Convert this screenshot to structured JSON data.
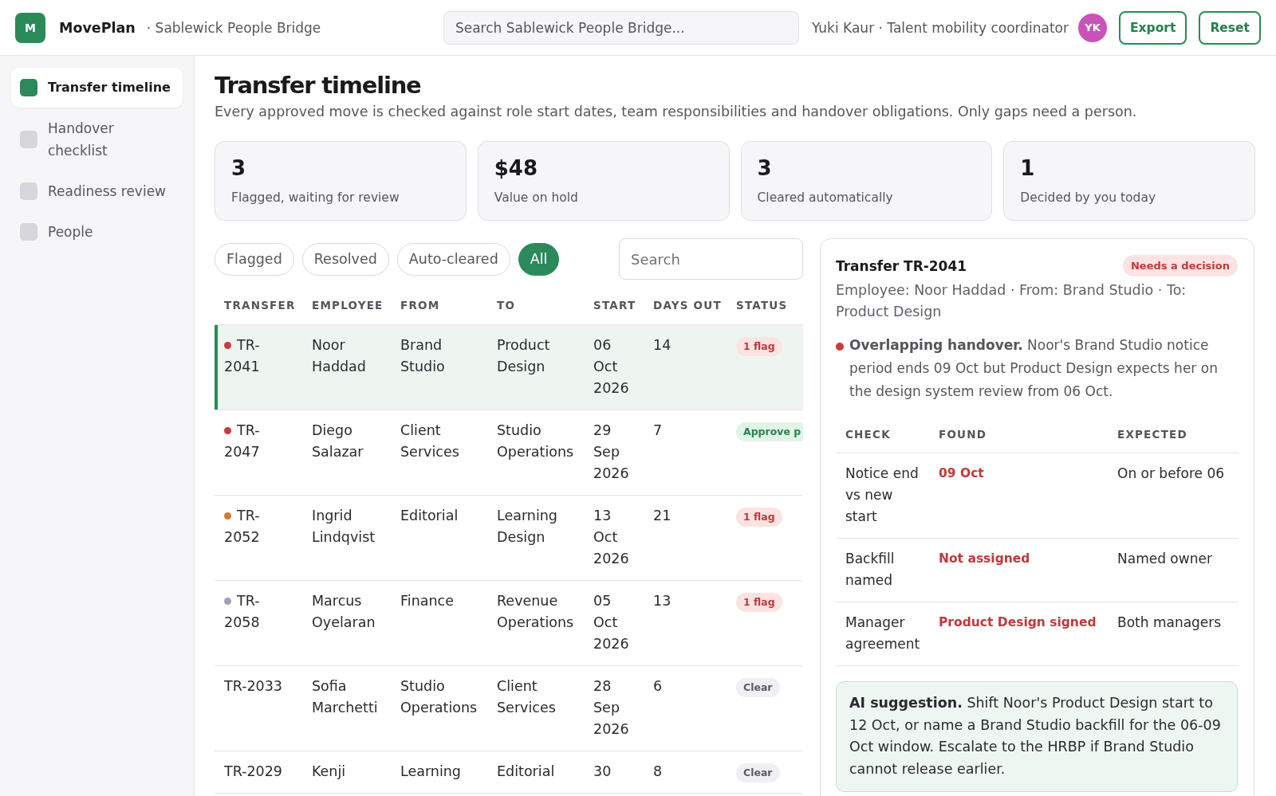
{
  "topbar": {
    "logo": "M",
    "app_name": "MovePlan",
    "workspace": "· Sablewick People Bridge",
    "search": {
      "placeholder": "Search Sablewick People Bridge..."
    },
    "user": "Yuki Kaur · Talent mobility coordinator",
    "avatar": "YK",
    "buttons": [
      "Export",
      "Reset"
    ]
  },
  "sidebar": {
    "items": [
      {
        "label": "Transfer timeline",
        "selected": true
      },
      {
        "label": "Handover checklist",
        "selected": false
      },
      {
        "label": "Readiness review",
        "selected": false
      },
      {
        "label": "People",
        "selected": false
      }
    ]
  },
  "page": {
    "title": "Transfer timeline",
    "subtitle": "Every approved move is checked against role start dates, team responsibilities and handover obligations. Only gaps need a person."
  },
  "stats": [
    {
      "value": "3",
      "label": "Flagged, waiting for review"
    },
    {
      "value": "$48",
      "label": "Value on hold"
    },
    {
      "value": "3",
      "label": "Cleared automatically"
    },
    {
      "value": "1",
      "label": "Decided by you today"
    }
  ],
  "filters": [
    {
      "label": "Flagged",
      "selected": false
    },
    {
      "label": "Resolved",
      "selected": false
    },
    {
      "label": "Auto-cleared",
      "selected": false
    },
    {
      "label": "All",
      "selected": true
    }
  ],
  "table_search": {
    "placeholder": "Search"
  },
  "table": {
    "columns": [
      "TRANSFER",
      "EMPLOYEE",
      "FROM",
      "TO",
      "START",
      "DAYS OUT",
      "STATUS"
    ],
    "rows": [
      {
        "transfer": "TR-2041",
        "color": "#c43c3c",
        "employee": "Noor Haddad",
        "from": "Brand Studio",
        "to": "Product Design",
        "start": "06 Oct 2026",
        "days_out": "14",
        "status": {
          "kind": "flag",
          "label": "1 flag"
        },
        "selected": true
      },
      {
        "transfer": "TR-2047",
        "color": "#c43c3c",
        "employee": "Diego Salazar",
        "from": "Client Services",
        "to": "Studio Operations",
        "start": "29 Sep 2026",
        "days_out": "7",
        "status": {
          "kind": "approve",
          "label": "Approve p"
        },
        "selected": false
      },
      {
        "transfer": "TR-2052",
        "color": "#d4792a",
        "employee": "Ingrid Lindqvist",
        "from": "Editorial",
        "to": "Learning Design",
        "start": "13 Oct 2026",
        "days_out": "21",
        "status": {
          "kind": "flag",
          "label": "1 flag"
        },
        "selected": false
      },
      {
        "transfer": "TR-2058",
        "color": "#a3a1b3",
        "employee": "Marcus Oyelaran",
        "from": "Finance",
        "to": "Revenue Operations",
        "start": "05 Oct 2026",
        "days_out": "13",
        "status": {
          "kind": "flag",
          "label": "1 flag"
        },
        "selected": false
      },
      {
        "transfer": "TR-2033",
        "employee": "Sofia Marchetti",
        "from": "Studio Operations",
        "to": "Client Services",
        "start": "28 Sep 2026",
        "days_out": "6",
        "status": {
          "kind": "clear",
          "label": "Clear"
        },
        "selected": false
      },
      {
        "transfer": "TR-2029",
        "employee": "Kenji",
        "from": "Learning",
        "to": "Editorial",
        "start": "30",
        "days_out": "8",
        "status": {
          "kind": "clear",
          "label": "Clear"
        },
        "selected": false
      }
    ]
  },
  "detail": {
    "title": "Transfer TR-2041",
    "badge": "Needs a decision",
    "meta": "Employee: Noor Haddad · From: Brand Studio · To: Product Design",
    "issue": "**Overlapping handover.** Noor's Brand Studio notice period ends 09 Oct but Product Design expects her on the design system review from 06 Oct.",
    "checks": {
      "columns": [
        "CHECK",
        "FOUND",
        "EXPECTED"
      ],
      "rows": [
        {
          "check": "Notice end vs new start",
          "found": "09 Oct",
          "expected": "On or before 06"
        },
        {
          "check": "Backfill named",
          "found": "Not assigned",
          "expected": "Named owner"
        },
        {
          "check": "Manager agreement",
          "found": "Product Design signed",
          "expected": "Both managers"
        }
      ]
    },
    "suggestion": "**AI suggestion.** Shift Noor's Product Design start to 12 Oct, or name a Brand Studio backfill for the 06-09 Oct window. Escalate to the HRBP if Brand Studio cannot release earlier."
  }
}
